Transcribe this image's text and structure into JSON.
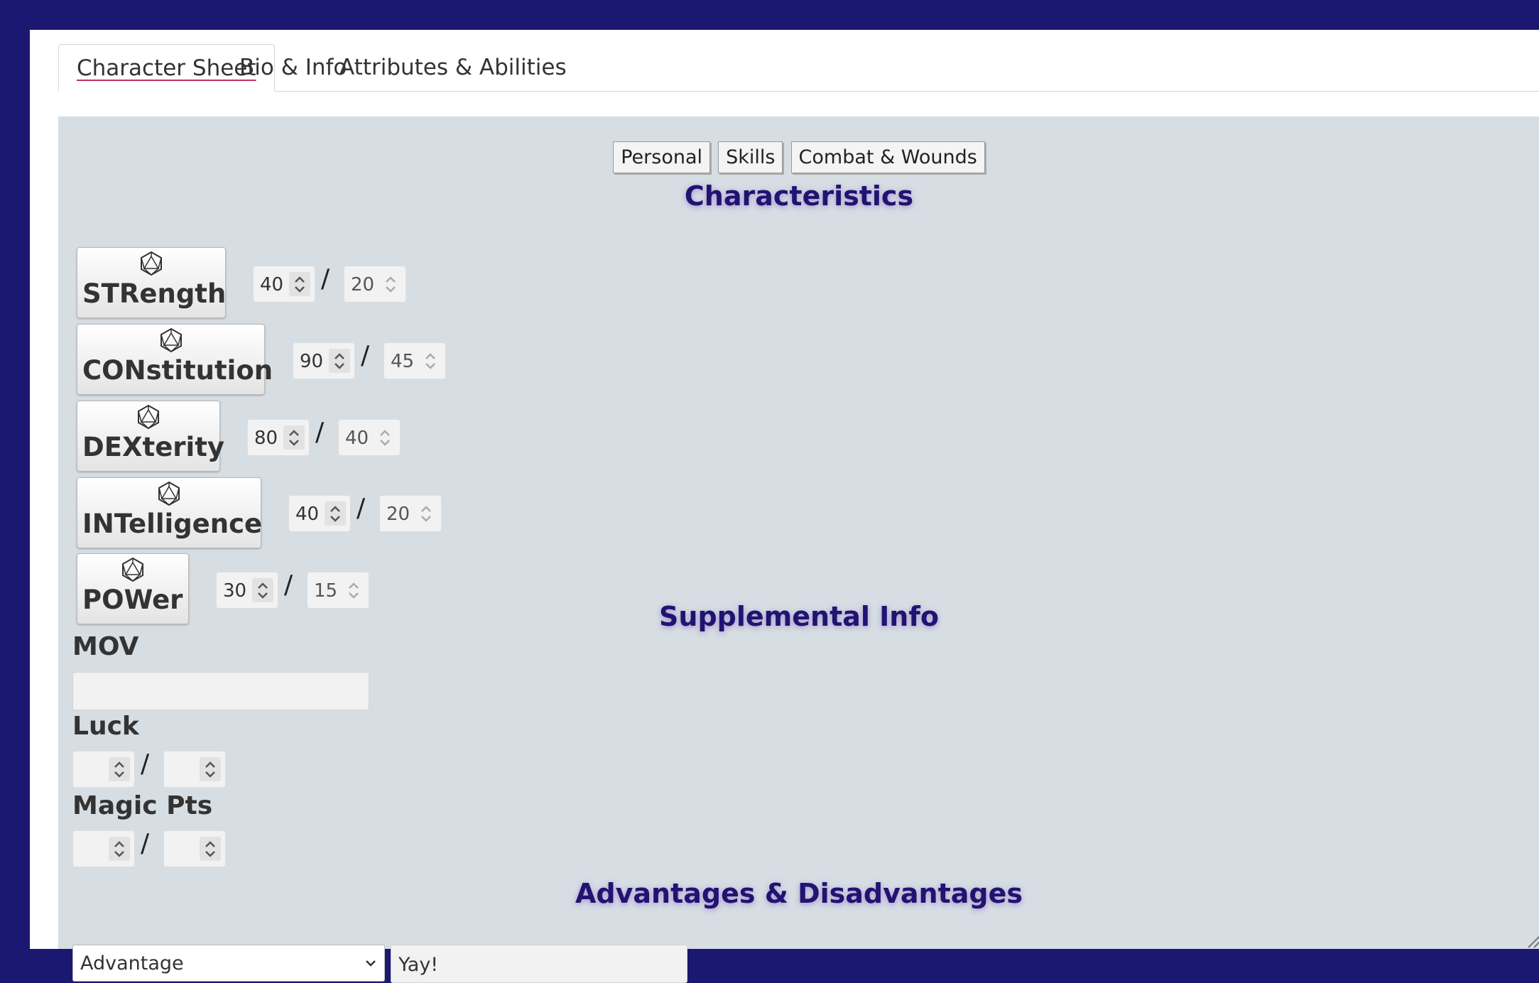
{
  "tabs": [
    {
      "label": "Character Sheet",
      "active": true
    },
    {
      "label": "Bio & Info",
      "active": false
    },
    {
      "label": "Attributes & Abilities",
      "active": false
    }
  ],
  "subnav": [
    "Personal",
    "Skills",
    "Combat & Wounds"
  ],
  "sections": {
    "characteristics": "Characteristics",
    "supplemental": "Supplemental Info",
    "advantages": "Advantages & Disadvantages"
  },
  "characteristics": [
    {
      "label": "STRength",
      "value": "40",
      "half": "20"
    },
    {
      "label": "CONstitution",
      "value": "90",
      "half": "45"
    },
    {
      "label": "DEXterity",
      "value": "80",
      "half": "40"
    },
    {
      "label": "INTelligence",
      "value": "40",
      "half": "20"
    },
    {
      "label": "POWer",
      "value": "30",
      "half": "15"
    }
  ],
  "supplemental": {
    "mov_label": "MOV",
    "mov_value": "",
    "luck_label": "Luck",
    "magic_label": "Magic Pts",
    "separator": "/"
  },
  "advantages": {
    "type_selected": "Advantage",
    "description": "Yay!"
  },
  "icons": {
    "characteristic_button": "d20-icon",
    "spinner": "spinner-arrows-icon",
    "select": "chevron-down-icon"
  },
  "colors": {
    "frame": "#1a1870",
    "panel": "#d6dde3",
    "heading": "#1f1470",
    "tab_underline": "#c0306a"
  }
}
